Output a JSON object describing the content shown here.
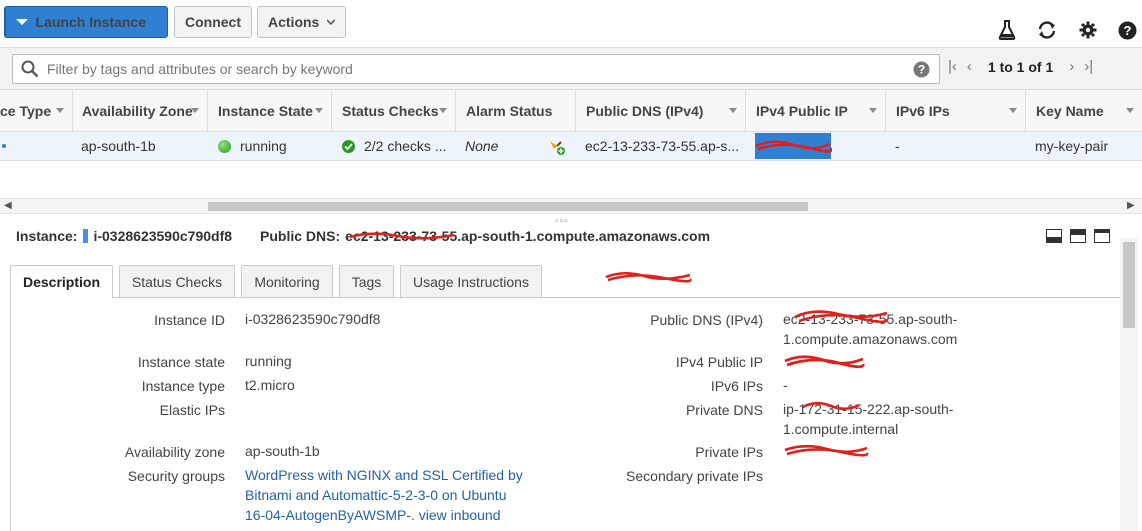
{
  "toolbar": {
    "launch_label": "Launch Instance",
    "connect_label": "Connect",
    "actions_label": "Actions"
  },
  "filter": {
    "placeholder": "Filter by tags and attributes or search by keyword"
  },
  "pager": {
    "text": "1 to 1 of 1"
  },
  "columns": [
    "ce Type",
    "Availability Zone",
    "Instance State",
    "Status Checks",
    "Alarm Status",
    "Public DNS (IPv4)",
    "IPv4 Public IP",
    "IPv6 IPs",
    "Key Name"
  ],
  "row": {
    "az": "ap-south-1b",
    "state": "running",
    "checks": "2/2 checks ...",
    "alarm": "None",
    "dns": "ec2-13-233-73-55.ap-s...",
    "ipv6": "-",
    "key": "my-key-pair"
  },
  "instance": {
    "label": "Instance:",
    "id": "i-0328623590c790df8",
    "dns_label": "Public DNS:",
    "dns": "ec2-13-233-73-55.ap-south-1.compute.amazonaws.com"
  },
  "tabs": [
    "Description",
    "Status Checks",
    "Monitoring",
    "Tags",
    "Usage Instructions"
  ],
  "details": {
    "instance_id_label": "Instance ID",
    "instance_id": "i-0328623590c790df8",
    "instance_state_label": "Instance state",
    "instance_state": "running",
    "instance_type_label": "Instance type",
    "instance_type": "t2.micro",
    "elastic_ips_label": "Elastic IPs",
    "az_label": "Availability zone",
    "az": "ap-south-1b",
    "sg_label": "Security groups",
    "sg_line1": "WordPress with NGINX and SSL Certified by",
    "sg_line2": "Bitnami and Automattic-5-2-3-0 on Ubuntu",
    "sg_line3": "16-04-AutogenByAWSMP-. view inbound",
    "public_dns_label": "Public DNS (IPv4)",
    "public_dns_line1": "ec2-13-233-73-55.ap-south-",
    "public_dns_line2": "1.compute.amazonaws.com",
    "ipv4_label": "IPv4 Public IP",
    "ipv6_label": "IPv6 IPs",
    "ipv6": "-",
    "private_dns_label": "Private DNS",
    "private_dns_line1": "ip-172-31-15-222.ap-south-",
    "private_dns_line2": "1.compute.internal",
    "private_ips_label": "Private IPs",
    "secondary_label": "Secondary private IPs"
  },
  "colors": {
    "primary": "#2f7fd3",
    "selected_row": "#eef4fc",
    "link": "#2461a8",
    "redaction": "#e0201a"
  }
}
